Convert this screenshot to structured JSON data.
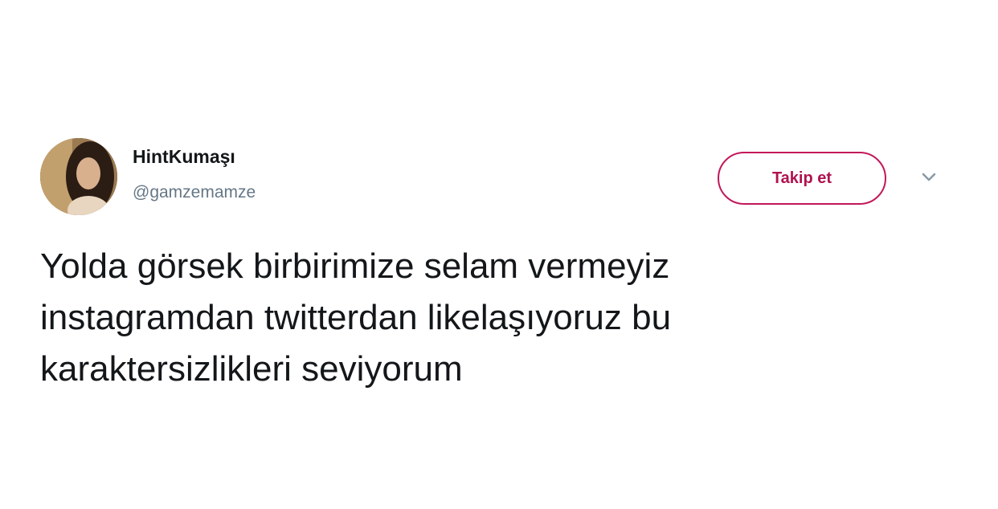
{
  "user": {
    "display_name": "HintKumaşı",
    "handle": "@gamzemamze",
    "avatar_icon": "profile-photo"
  },
  "follow_button": {
    "label": "Takip et",
    "accent_color": "#c2185b"
  },
  "menu": {
    "icon": "chevron-down-icon"
  },
  "tweet": {
    "lines": [
      "Yolda görsek birbirimize selam vermeyiz",
      "instagramdan twitterdan likelaşıyoruz bu",
      "karaktersizlikleri seviyorum"
    ]
  }
}
